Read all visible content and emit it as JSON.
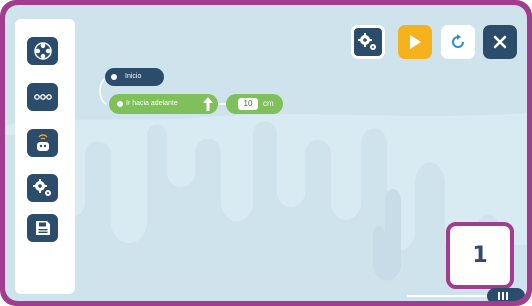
{
  "colors": {
    "frame": "#a23c8e",
    "canvas": "#cfe3ec",
    "navy": "#2c4c6b",
    "green": "#7fc05a",
    "orange": "#f6b21c",
    "white": "#ffffff"
  },
  "sidebar": {
    "items": [
      {
        "icon": "gamepad-icon"
      },
      {
        "icon": "more-dots-icon"
      },
      {
        "icon": "robot-icon"
      },
      {
        "icon": "gears-icon"
      },
      {
        "icon": "save-icon"
      }
    ]
  },
  "toolbar": {
    "buttons": [
      {
        "icon": "settings-gears-icon"
      },
      {
        "icon": "play-icon"
      },
      {
        "icon": "reset-icon"
      },
      {
        "icon": "close-icon"
      }
    ]
  },
  "program": {
    "start_label": "Inicio",
    "move_label": "Ir hacia adelante",
    "move_icon": "arrow-up-icon",
    "distance_value": "10",
    "distance_unit": "cm"
  },
  "callout": {
    "number": "1"
  },
  "zoom": {
    "minus": "−",
    "plus": "+",
    "handle_icon": "grip-lines-icon"
  }
}
